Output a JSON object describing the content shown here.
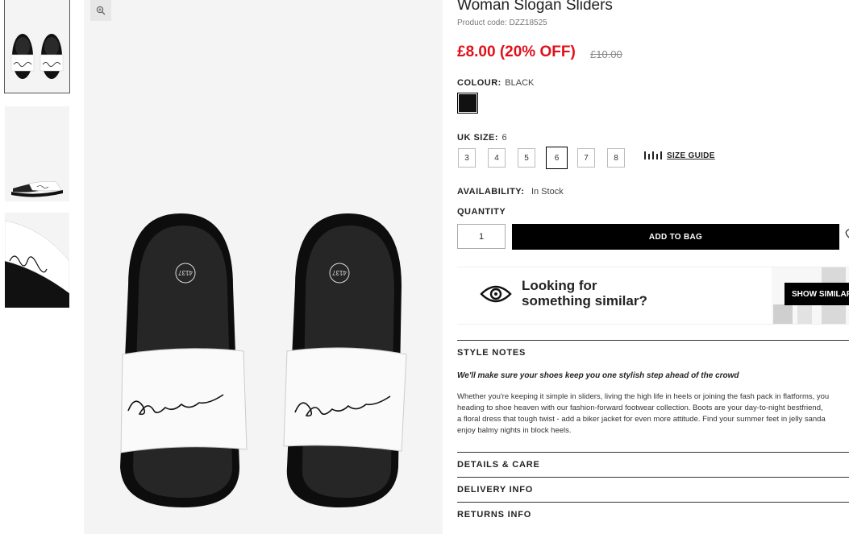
{
  "product": {
    "title": "Woman Slogan Sliders",
    "code": "Product code: DZZ18525",
    "price": "£8.00 (20% OFF)",
    "old_price": "£10.00",
    "colour_label": "COLOUR:",
    "colour_value": "BLACK",
    "size_label": "UK SIZE:",
    "size_value": "6",
    "sizes": [
      "3",
      "4",
      "5",
      "6",
      "7",
      "8"
    ],
    "selected_size": "6",
    "size_guide": "SIZE GUIDE",
    "availability_label": "AVAILABILITY:",
    "availability_value": "In Stock",
    "quantity_label": "QUANTITY",
    "quantity_value": "1",
    "add_to_bag": "ADD TO BAG",
    "insole_size": "4137"
  },
  "similar": {
    "line1": "Looking for",
    "line2": "something similar?",
    "button": "SHOW SIMILAR"
  },
  "sections": {
    "style_notes": "STYLE NOTES",
    "tagline": "We'll make sure your shoes keep you one stylish step ahead of the crowd",
    "description_lines": [
      "Whether you're keeping it simple in sliders, living the high life in heels or joining the fash pack in flatforms, you",
      "heading to shoe heaven with our fashion-forward footwear collection. Boots are your day-to-night bestfriend,",
      "a floral dress that tough twist - add a biker jacket for even more attitude. Find your summer feet in jelly sanda",
      "enjoy balmy nights in block heels."
    ],
    "details_care": "DETAILS & CARE",
    "delivery_info": "DELIVERY INFO",
    "returns_info": "RETURNS INFO"
  },
  "colors": {
    "sale_red": "#e0101a",
    "black": "#000000"
  }
}
